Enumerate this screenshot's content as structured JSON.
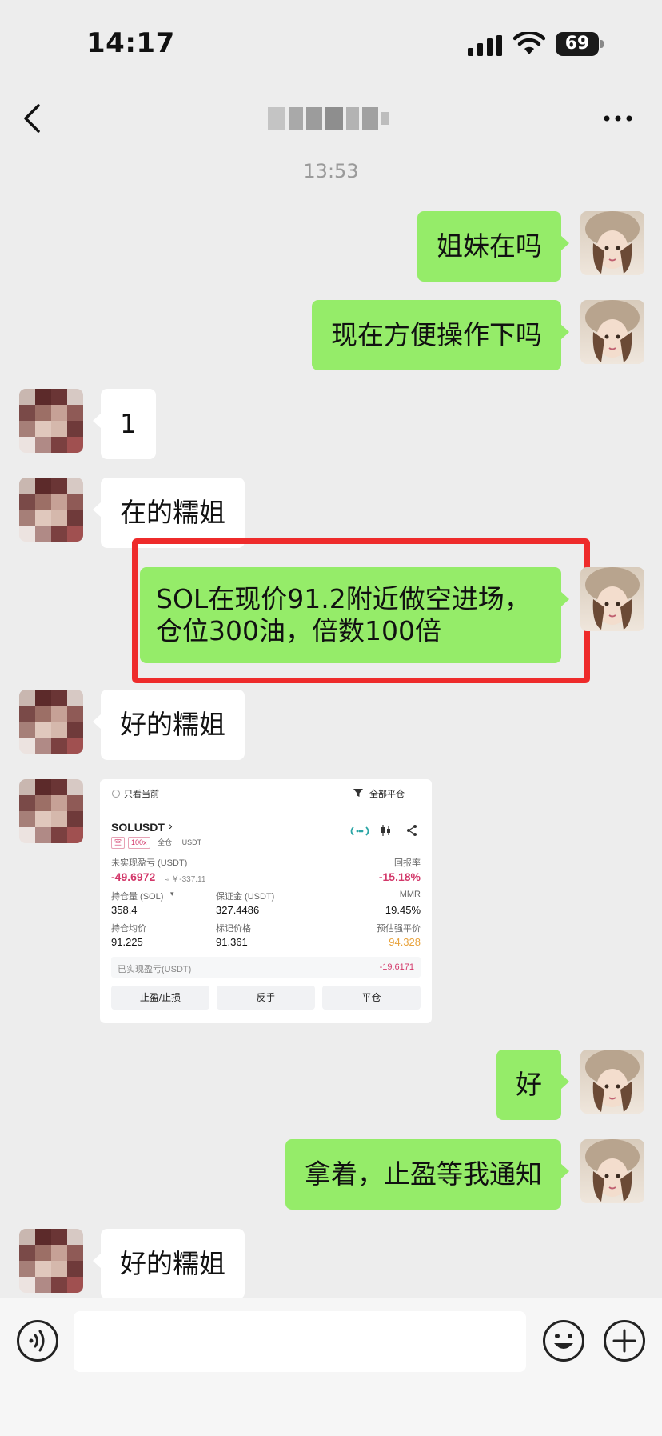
{
  "status_bar": {
    "time": "14:17",
    "battery": "69"
  },
  "nav": {
    "title": "",
    "back_icon": "chevron-left-icon",
    "more_icon": "ellipsis-icon"
  },
  "timestamp": "13:53",
  "messages": [
    {
      "from": "me",
      "text": "姐妹在吗"
    },
    {
      "from": "me",
      "text": "现在方便操作下吗"
    },
    {
      "from": "other",
      "text": "1"
    },
    {
      "from": "other",
      "text": "在的糯姐"
    },
    {
      "from": "me",
      "text": "SOL在现价91.2附近做空进场，仓位300油，倍数100倍"
    },
    {
      "from": "other",
      "text": "好的糯姐"
    },
    {
      "from": "other",
      "type": "image",
      "text": ""
    },
    {
      "from": "me",
      "text": "好"
    },
    {
      "from": "me",
      "text": "拿着，止盈等我通知"
    },
    {
      "from": "other",
      "text": "好的糯姐"
    }
  ],
  "trade_card": {
    "filter_label": "只看当前",
    "close_all": "全部平仓",
    "symbol": "SOLUSDT",
    "tag_side": "空",
    "tag_leverage": "100x",
    "margin_mode": "全仓",
    "currency": "USDT",
    "unrealized_label": "未实现盈亏 (USDT)",
    "unrealized_value": "-49.6972",
    "unrealized_cny": "≈ ￥-337.11",
    "roi_label": "回报率",
    "roi_value": "-15.18%",
    "position_label": "持仓量 (SOL)",
    "position_value": "358.4",
    "margin_label": "保证金 (USDT)",
    "margin_value": "327.4486",
    "mmr_label": "MMR",
    "mmr_value": "19.45%",
    "entry_label": "持仓均价",
    "entry_value": "91.225",
    "mark_label": "标记价格",
    "mark_value": "91.361",
    "liq_label": "预估强平价",
    "liq_value": "94.328",
    "realized_label": "已实现盈亏(USDT)",
    "realized_value": "-19.6171",
    "btn_tpsl": "止盈/止损",
    "btn_reverse": "反手",
    "btn_close": "平仓",
    "colors": {
      "loss": "#d3386a",
      "liq": "#e8a33d"
    }
  },
  "input_bar": {
    "placeholder": ""
  },
  "colors": {
    "my_bubble": "#95ec69",
    "other_bubble": "#ffffff",
    "background": "#ededed",
    "highlight": "#ee2b2b"
  }
}
